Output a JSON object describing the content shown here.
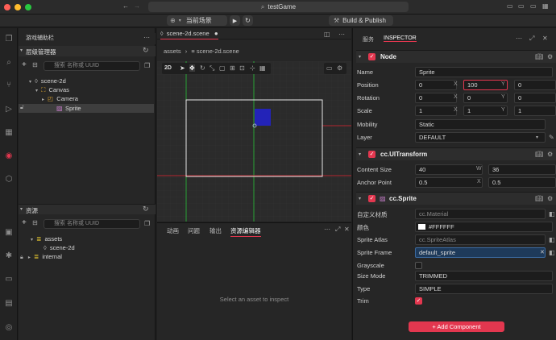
{
  "window": {
    "title": "testGame"
  },
  "toolbar": {
    "scene_select": "当前场景",
    "build_label": "Build & Publish"
  },
  "node_panel": {
    "title": "游戏辅助栏",
    "hierarchy_title": "层级管理器",
    "search_placeholder": "搜索 名称或 UUID",
    "tree": [
      "scene-2d",
      "Canvas",
      "Camera",
      "Sprite"
    ]
  },
  "assets_panel": {
    "title": "资源",
    "search_placeholder": "搜索 名称或 UUID",
    "tree": [
      "assets",
      "scene-2d",
      "internal"
    ]
  },
  "scene": {
    "tab_label": "scene-2d.scene",
    "breadcrumb_root": "assets",
    "breadcrumb_file": "scene-2d.scene",
    "mode_2d": "2D"
  },
  "bottom_panel": {
    "tabs": [
      "动画",
      "问题",
      "输出",
      "资源编辑器"
    ],
    "placeholder": "Select an asset to inspect"
  },
  "inspector": {
    "tabs": [
      "服务",
      "INSPECTOR"
    ],
    "node_section": "Node",
    "name_label": "Name",
    "name_value": "Sprite",
    "position_label": "Position",
    "position": [
      "0",
      "100",
      "0"
    ],
    "rotation_label": "Rotation",
    "rotation": [
      "0",
      "0",
      "0"
    ],
    "scale_label": "Scale",
    "scale": [
      "1",
      "1",
      "1"
    ],
    "axes": [
      "X",
      "Y",
      "Z"
    ],
    "mobility_label": "Mobility",
    "mobility_value": "Static",
    "layer_label": "Layer",
    "layer_value": "DEFAULT",
    "transform_section": "cc.UITransform",
    "content_size_label": "Content Size",
    "content_size": [
      "40",
      "36"
    ],
    "size_axes": [
      "W",
      "H"
    ],
    "anchor_label": "Anchor Point",
    "anchor": [
      "0.5",
      "0.5"
    ],
    "anchor_axes": [
      "X",
      "Y"
    ],
    "sprite_section": "cc.Sprite",
    "custom_material_label": "自定义材质",
    "custom_material_value": "cc.Material",
    "color_label": "颜色",
    "color_value": "#FFFFFF",
    "atlas_label": "Sprite Atlas",
    "atlas_value": "cc.SpriteAtlas",
    "frame_label": "Sprite Frame",
    "frame_value": "default_sprite",
    "grayscale_label": "Grayscale",
    "size_mode_label": "Size Mode",
    "size_mode_value": "TRIMMED",
    "type_label": "Type",
    "type_value": "SIMPLE",
    "trim_label": "Trim",
    "add_component": "+ Add Component"
  },
  "colors": {
    "accent": "#e3374f",
    "selection": "#3e3e3e",
    "sprite_blue": "#2323b8"
  }
}
